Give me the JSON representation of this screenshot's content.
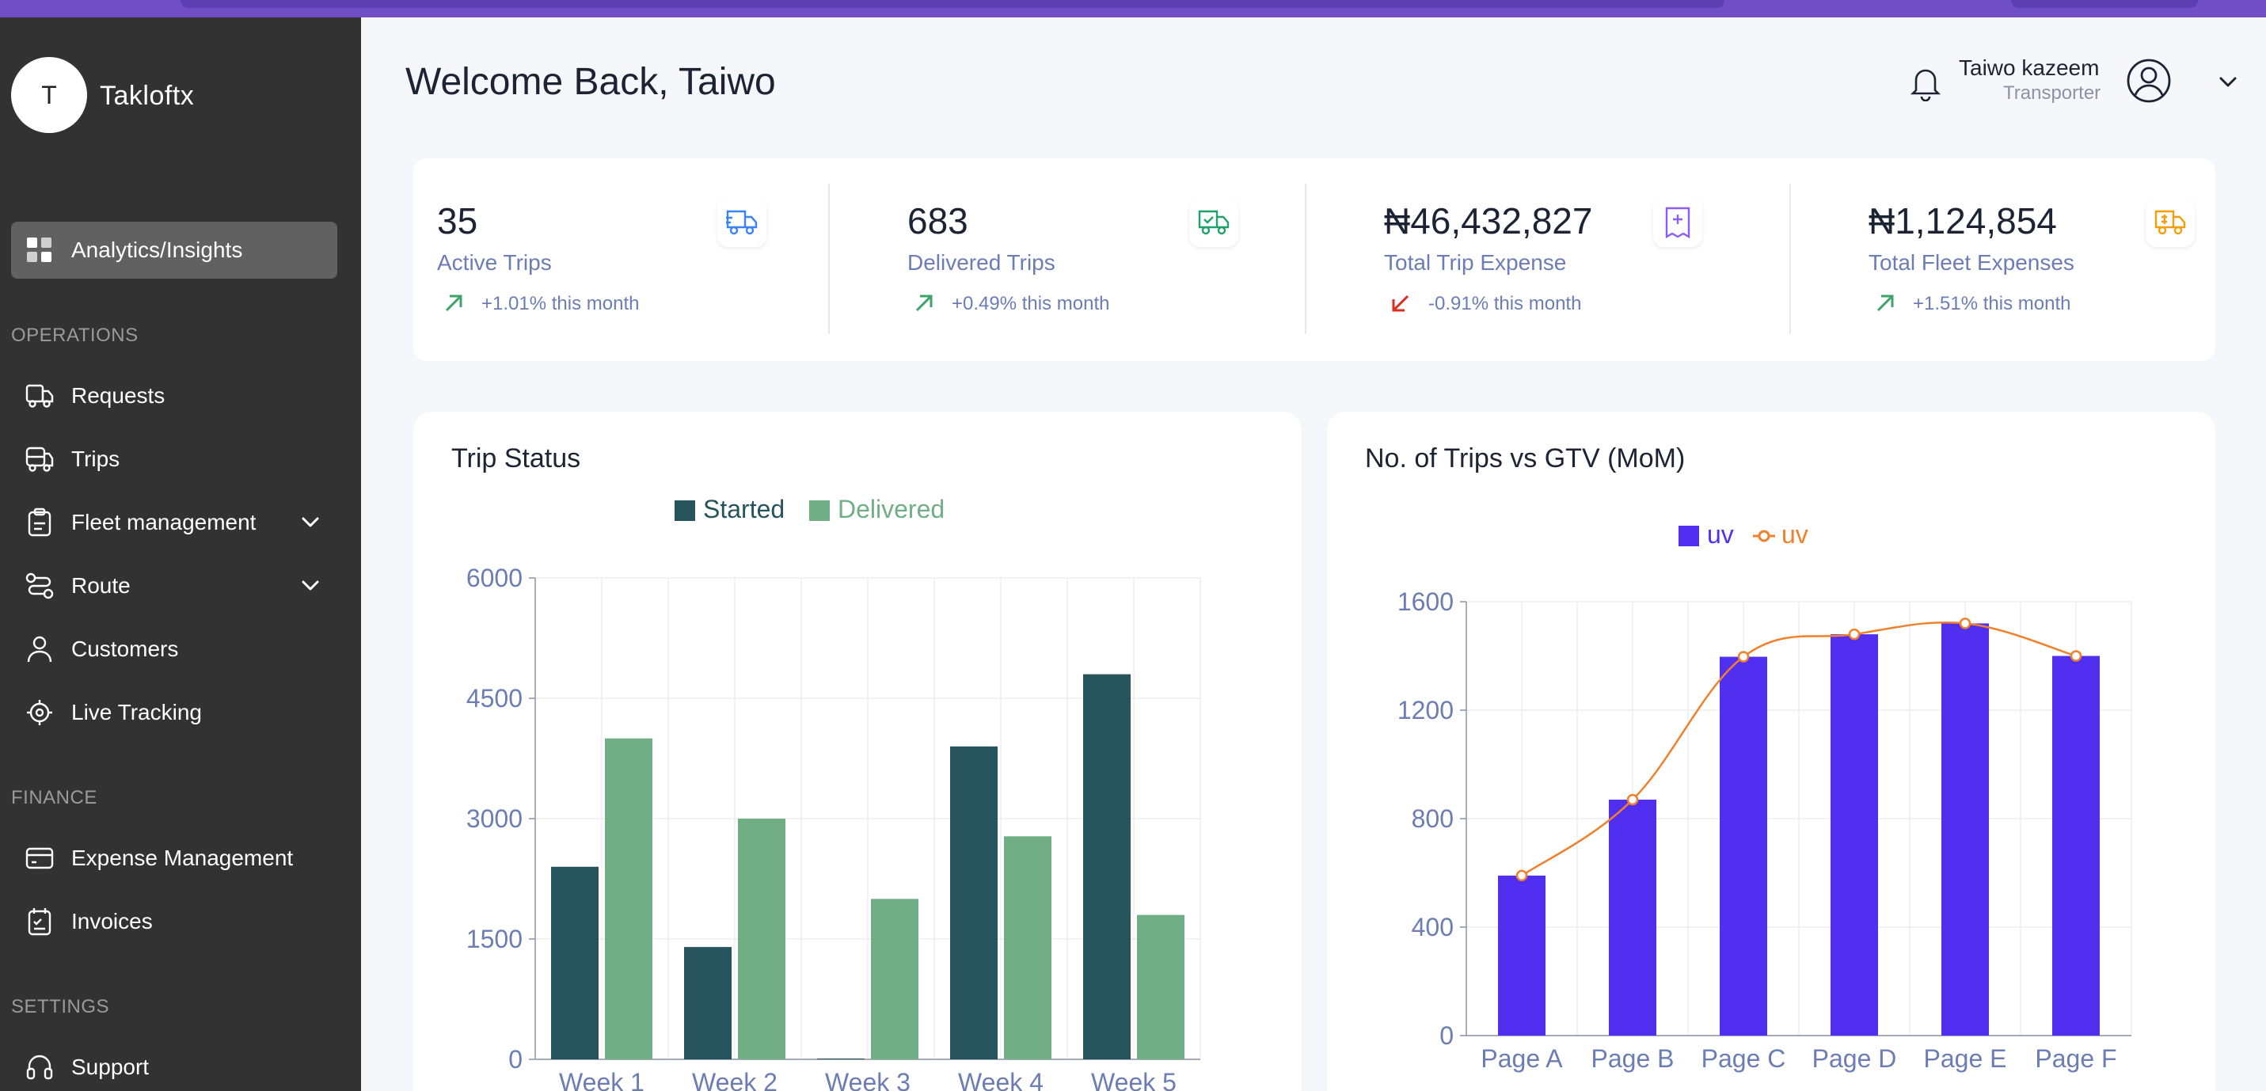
{
  "app": {
    "name": "Takloftx",
    "avatar_letter": "T"
  },
  "sidebar": {
    "active": {
      "label": "Analytics/Insights",
      "icon": "dashboard-icon"
    },
    "sections": [
      {
        "label": "OPERATIONS",
        "items": [
          {
            "label": "Requests",
            "icon": "truck-icon"
          },
          {
            "label": "Trips",
            "icon": "bus-icon"
          },
          {
            "label": "Fleet management",
            "icon": "clipboard-icon",
            "expandable": true
          },
          {
            "label": "Route",
            "icon": "route-icon",
            "expandable": true
          },
          {
            "label": "Customers",
            "icon": "user-icon"
          },
          {
            "label": "Live Tracking",
            "icon": "target-icon"
          }
        ]
      },
      {
        "label": "FINANCE",
        "items": [
          {
            "label": "Expense Management",
            "icon": "card-icon"
          },
          {
            "label": "Invoices",
            "icon": "invoice-icon"
          }
        ]
      },
      {
        "label": "SETTINGS",
        "items": [
          {
            "label": "Support",
            "icon": "headset-icon"
          }
        ]
      }
    ]
  },
  "header": {
    "title": "Welcome Back, Taiwo",
    "user_name": "Taiwo kazeem",
    "user_role": "Transporter"
  },
  "stats": [
    {
      "value": "35",
      "label": "Active Trips",
      "trend": "+1.01% this month",
      "direction": "up",
      "icon": "truck-fast-icon",
      "icon_color": "#3b82f6"
    },
    {
      "value": "683",
      "label": "Delivered Trips",
      "trend": "+0.49% this month",
      "direction": "up",
      "icon": "truck-check-icon",
      "icon_color": "#22a06b"
    },
    {
      "value": "₦46,432,827",
      "label": "Total Trip Expense",
      "trend": "-0.91% this month",
      "direction": "down",
      "icon": "receipt-icon",
      "icon_color": "#8b5cf6"
    },
    {
      "value": "₦1,124,854",
      "label": "Total Fleet Expenses",
      "trend": "+1.51% this month",
      "direction": "up",
      "icon": "truck-cost-icon",
      "icon_color": "#f59e0b"
    }
  ],
  "colors": {
    "up": "#3fa36b",
    "down": "#d92d20",
    "started": "#27545c",
    "delivered": "#71ae86",
    "bar": "#512ff0",
    "line": "#f0802b",
    "axis_text": "#6b7db3"
  },
  "chart_data": [
    {
      "type": "bar",
      "title": "Trip Status",
      "categories": [
        "Week 1",
        "Week 2",
        "Week 3",
        "Week 4",
        "Week 5"
      ],
      "series": [
        {
          "name": "Started",
          "values": [
            2400,
            1400,
            10,
            3900,
            4800
          ]
        },
        {
          "name": "Delivered",
          "values": [
            4000,
            3000,
            2000,
            2780,
            1800
          ]
        }
      ],
      "yticks": [
        "0",
        "1500",
        "3000",
        "4500",
        "6000"
      ],
      "ylim": [
        0,
        6000
      ],
      "grid": true,
      "legend": "top-center"
    },
    {
      "type": "bar",
      "title": "No. of Trips vs GTV (MoM)",
      "categories": [
        "Page A",
        "Page B",
        "Page C",
        "Page D",
        "Page E",
        "Page F"
      ],
      "series": [
        {
          "name": "uv",
          "kind": "bar",
          "values": [
            590,
            870,
            1397,
            1480,
            1520,
            1400
          ]
        },
        {
          "name": "uv",
          "kind": "line",
          "values": [
            590,
            870,
            1397,
            1480,
            1520,
            1400
          ]
        }
      ],
      "yticks": [
        "0",
        "400",
        "800",
        "1200",
        "1600"
      ],
      "ylim": [
        0,
        1600
      ],
      "grid": true,
      "legend": "top-center"
    }
  ]
}
